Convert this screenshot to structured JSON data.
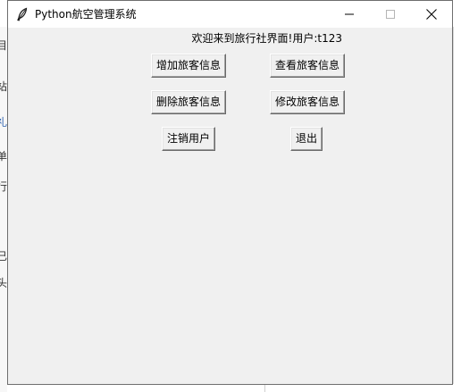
{
  "window": {
    "title": "Python航空管理系统"
  },
  "welcome_text": "欢迎来到旅行社界面!用户:t123",
  "buttons": {
    "add_passenger": "增加旅客信息",
    "view_passenger": "查看旅客信息",
    "delete_passenger": "删除旅客信息",
    "modify_passenger": "修改旅客信息",
    "logout": "注销用户",
    "exit": "退出"
  },
  "background_fragments": [
    "目",
    "站",
    "礼",
    "单",
    "行",
    "已",
    "头"
  ],
  "icons": {
    "app": "feather-icon",
    "minimize": "minimize-icon",
    "maximize": "maximize-icon",
    "close": "close-icon"
  }
}
